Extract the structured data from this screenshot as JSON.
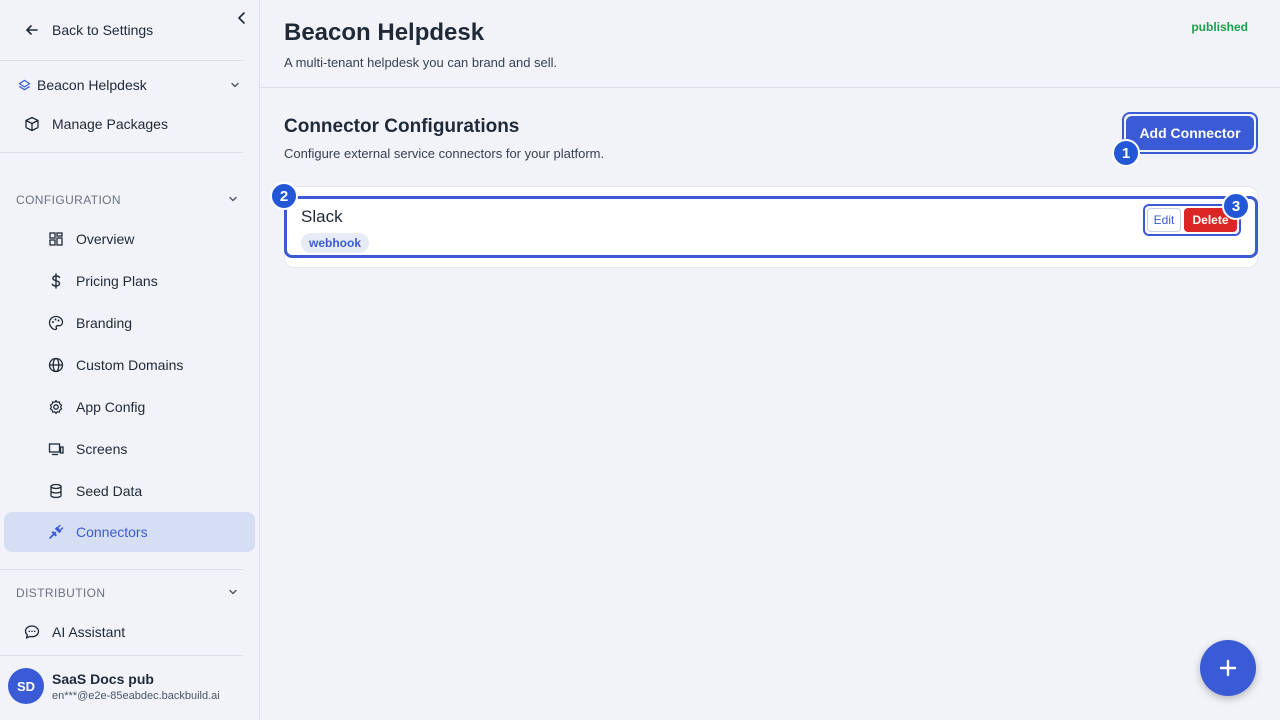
{
  "sidebar": {
    "back_label": "Back to Settings",
    "project": {
      "name": "Beacon Helpdesk"
    },
    "manage_packages": "Manage Packages",
    "configuration": {
      "title": "CONFIGURATION",
      "items": [
        {
          "label": "Overview",
          "icon": "dashboard-icon"
        },
        {
          "label": "Pricing Plans",
          "icon": "dollar-icon"
        },
        {
          "label": "Branding",
          "icon": "palette-icon"
        },
        {
          "label": "Custom Domains",
          "icon": "globe-icon"
        },
        {
          "label": "App Config",
          "icon": "gear-icon"
        },
        {
          "label": "Screens",
          "icon": "monitor-icon"
        },
        {
          "label": "Seed Data",
          "icon": "database-icon"
        },
        {
          "label": "Connectors",
          "icon": "plug-icon",
          "active": true
        }
      ]
    },
    "distribution": {
      "title": "DISTRIBUTION",
      "items": [
        {
          "label": "AI Assistant",
          "icon": "chat-icon"
        }
      ]
    },
    "user": {
      "initials": "SD",
      "name": "SaaS Docs pub",
      "email": "en***@e2e-85eabdec.backbuild.ai"
    }
  },
  "header": {
    "title": "Beacon Helpdesk",
    "subtitle": "A multi-tenant helpdesk you can brand and sell.",
    "status": "published"
  },
  "section": {
    "title": "Connector Configurations",
    "subtitle": "Configure external service connectors for your platform.",
    "add_label": "Add Connector"
  },
  "connectors": [
    {
      "name": "Slack",
      "type": "webhook",
      "edit_label": "Edit",
      "delete_label": "Delete"
    }
  ],
  "badges": [
    "1",
    "2",
    "3"
  ],
  "colors": {
    "accent": "#3b5bd6",
    "danger": "#dc2626",
    "success": "#16a34a",
    "badge": "#2457d6"
  }
}
